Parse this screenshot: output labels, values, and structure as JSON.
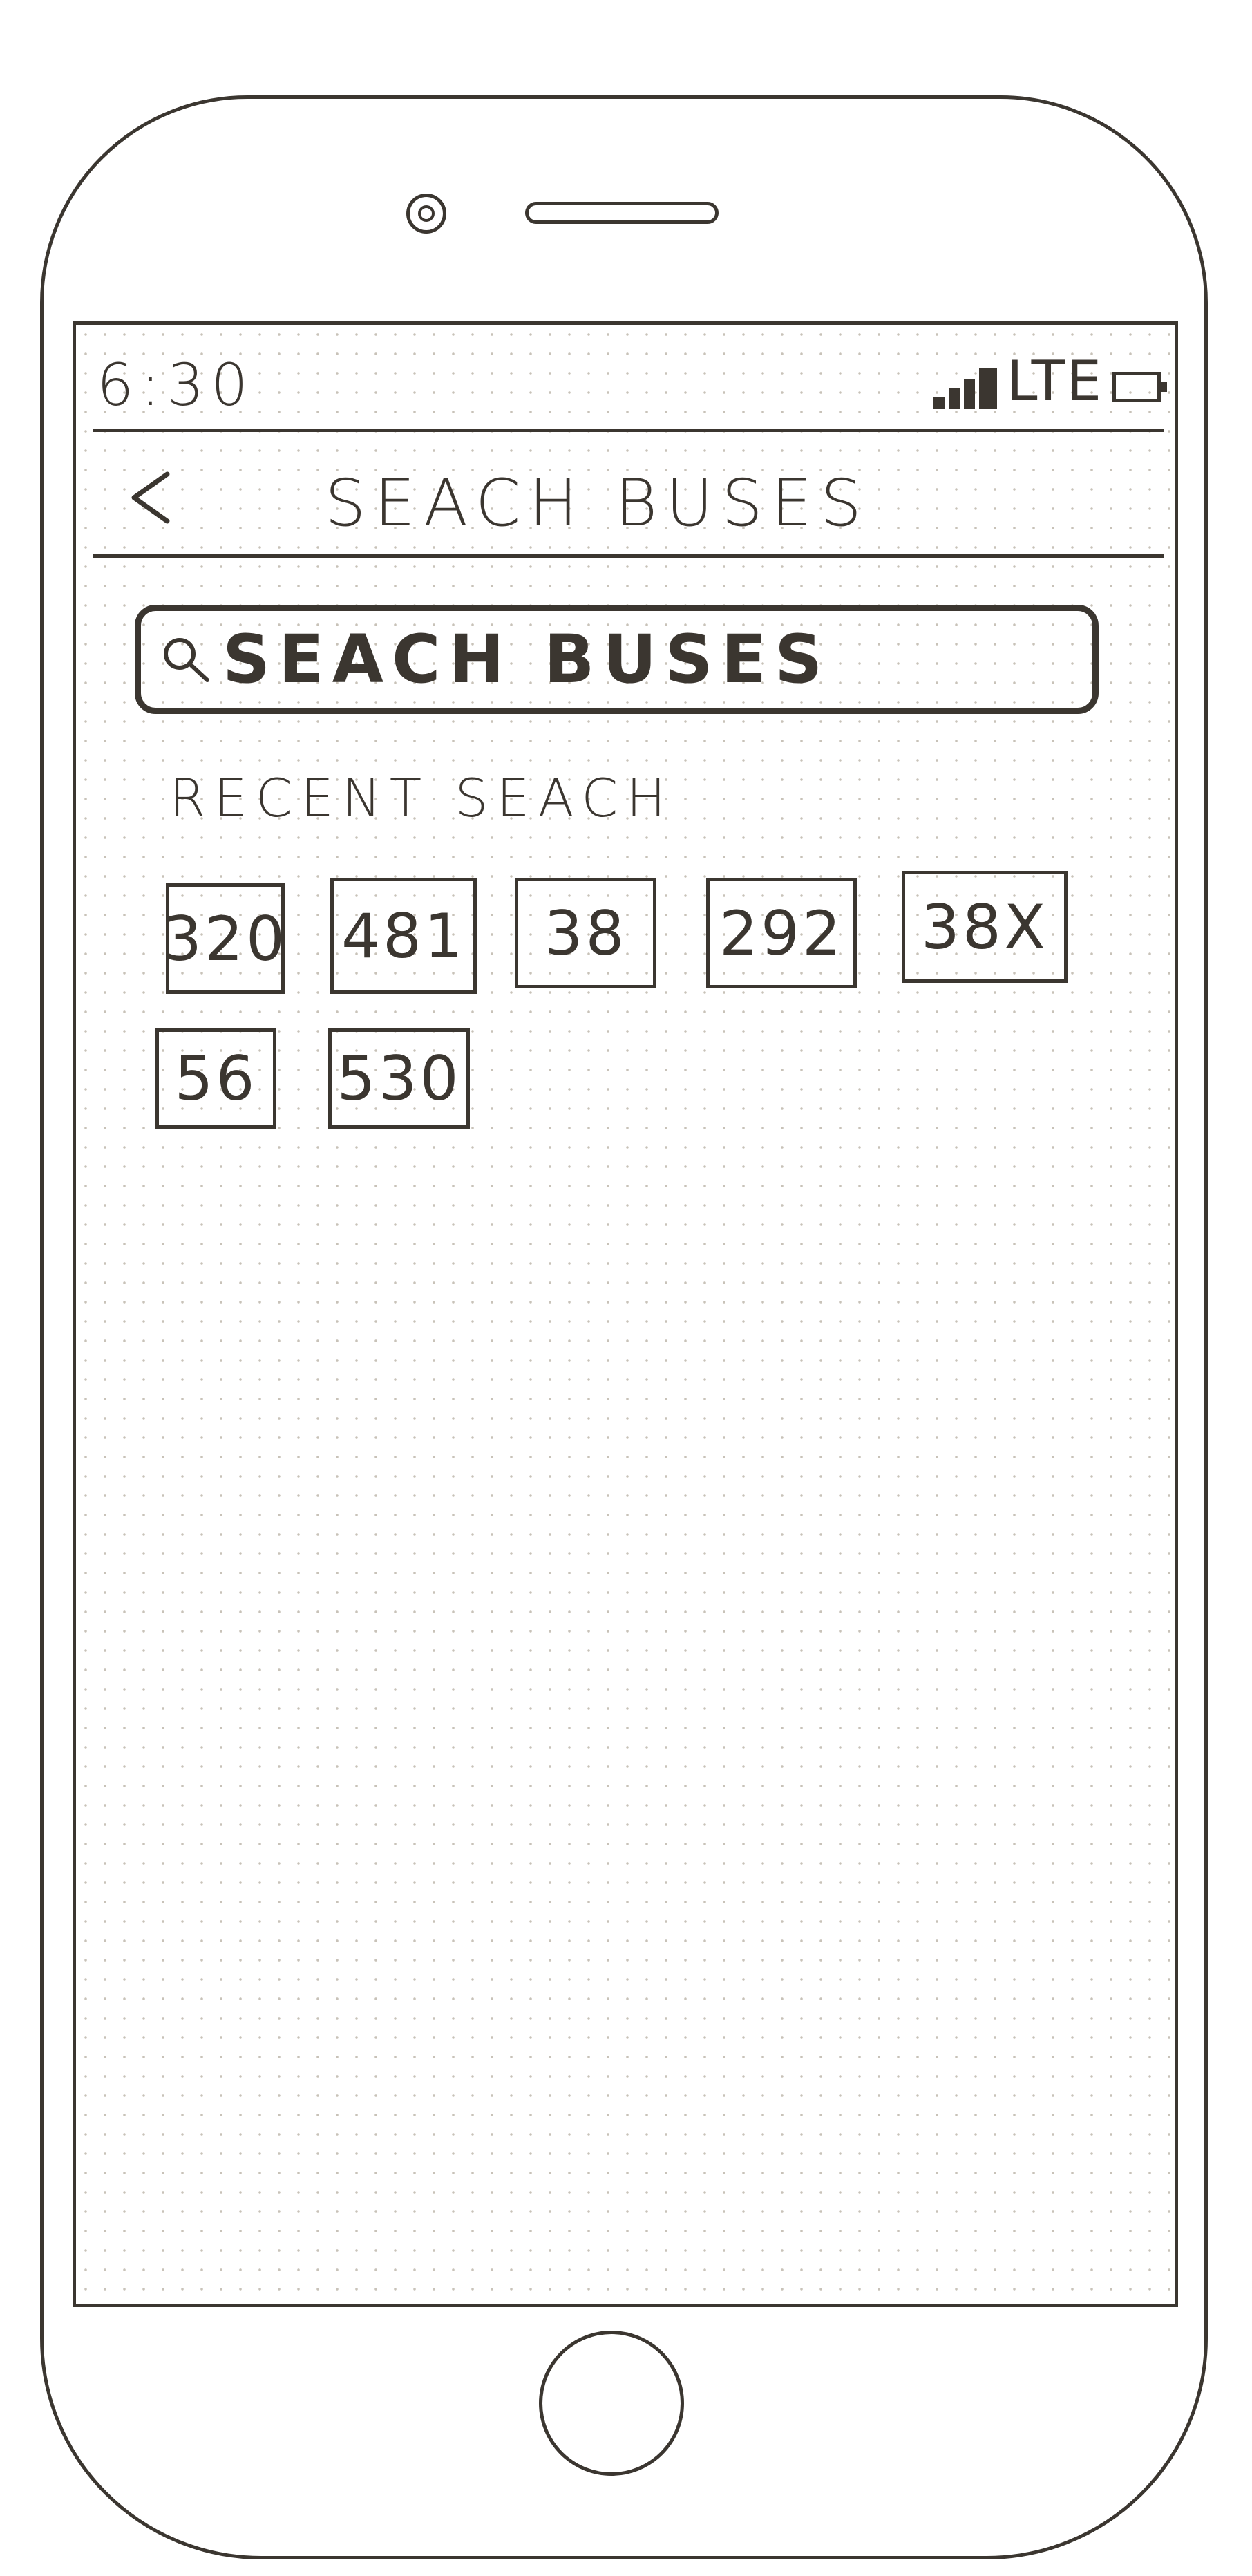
{
  "status_bar": {
    "time": "6:30",
    "network": "LTE",
    "icons": [
      "signal-icon",
      "battery-icon"
    ]
  },
  "header": {
    "back_icon": "chevron-left-icon",
    "title": "SEACH BUSES"
  },
  "search": {
    "icon": "search-icon",
    "placeholder": "SEACH BUSES"
  },
  "recent": {
    "label": "RECENT SEACH",
    "items": [
      "320",
      "481",
      "38",
      "292",
      "38X",
      "56",
      "530"
    ]
  },
  "colors": {
    "ink": "#3b3630",
    "paper": "#ffffff",
    "dots": "#c8c2b8"
  }
}
